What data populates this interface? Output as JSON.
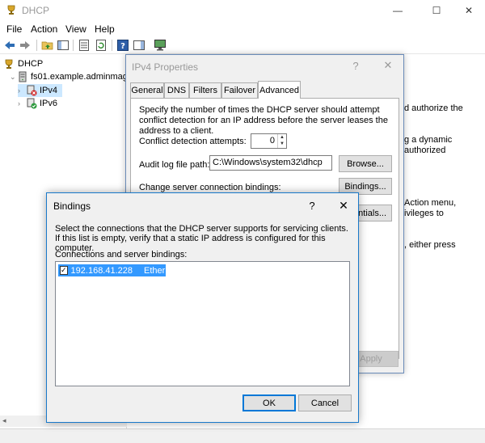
{
  "window": {
    "title": "DHCP",
    "controls": {
      "minimize": "—",
      "maximize": "☐",
      "close": "✕"
    }
  },
  "menu": [
    "File",
    "Action",
    "View",
    "Help"
  ],
  "tree": {
    "root": "DHCP",
    "server": "fs01.example.adminmag",
    "ipv4": "IPv4",
    "ipv6": "IPv6"
  },
  "right_pane": {
    "lines": [
      "d authorize the",
      "g a dynamic",
      "authorized",
      "Action menu,",
      "ivileges to",
      ", either press"
    ]
  },
  "ipv4_dialog": {
    "title": "IPv4 Properties",
    "help": "?",
    "close": "✕",
    "tabs": [
      "General",
      "DNS",
      "Filters",
      "Failover",
      "Advanced"
    ],
    "active_tab": "Advanced",
    "description": "Specify the number of times the DHCP server should attempt conflict detection for an IP address before the server leases the address to a client.",
    "conflict_label": "Conflict detection attempts:",
    "conflict_value": "0",
    "audit_label": "Audit log file path:",
    "audit_value": "C:\\Windows\\system32\\dhcp",
    "browse_button": "Browse...",
    "bindings_label": "Change server connection bindings:",
    "bindings_button": "Bindings...",
    "credentials_button": "entials...",
    "apply_button": "Apply"
  },
  "bindings_dialog": {
    "title": "Bindings",
    "help": "?",
    "close": "✕",
    "description": "Select the connections that the DHCP server supports for servicing clients. If this list is empty, verify that a static IP address is configured for this computer.",
    "list_label": "Connections and server bindings:",
    "rows": [
      {
        "checked": true,
        "check_glyph": "✓",
        "ip": "192.168.41.228",
        "name": "Ethernet"
      }
    ],
    "ok_button": "OK",
    "cancel_button": "Cancel"
  }
}
